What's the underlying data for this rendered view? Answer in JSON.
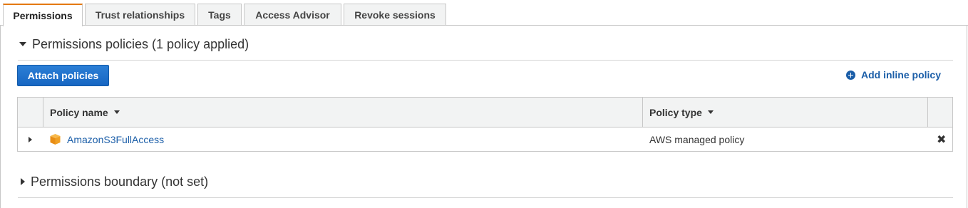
{
  "tabs": [
    {
      "label": "Permissions",
      "active": true
    },
    {
      "label": "Trust relationships",
      "active": false
    },
    {
      "label": "Tags",
      "active": false
    },
    {
      "label": "Access Advisor",
      "active": false
    },
    {
      "label": "Revoke sessions",
      "active": false
    }
  ],
  "permissions_section": {
    "title": "Permissions policies (1 policy applied)",
    "expanded": true,
    "attach_button": "Attach policies",
    "add_inline_link": "Add inline policy"
  },
  "table": {
    "columns": [
      "Policy name",
      "Policy type"
    ],
    "rows": [
      {
        "name": "AmazonS3FullAccess",
        "type": "AWS managed policy",
        "remove": "✖"
      }
    ]
  },
  "boundary_section": {
    "title": "Permissions boundary (not set)",
    "expanded": false
  },
  "colors": {
    "accent_tab": "#e47911",
    "link": "#1b5ea8",
    "primary_button": "#1766c2",
    "aws_cube": "#f0a024"
  },
  "icons": {
    "row_icon": "aws-managed-cube-icon",
    "add_inline": "plus-circle-icon",
    "remove": "close-icon"
  }
}
